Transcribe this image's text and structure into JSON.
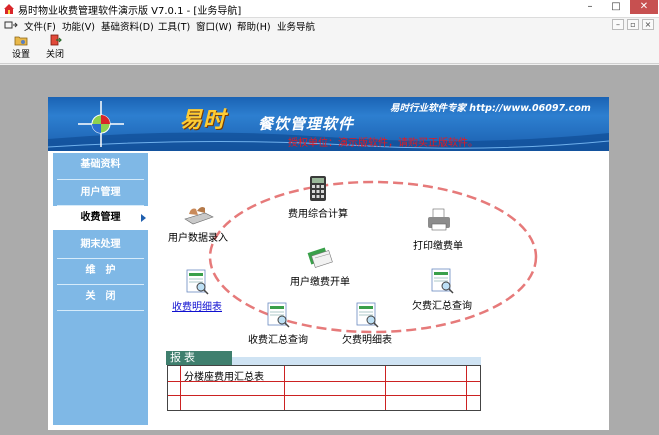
{
  "window": {
    "title": "易时物业收费管理软件演示版 V7.0.1 - [业务导航]",
    "controls": {
      "minimize": "–",
      "maximize": "□",
      "close": "✕"
    }
  },
  "menubar": {
    "items": [
      "文件(F)",
      "功能(V)",
      "基础资料(D)",
      "工具(T)",
      "窗口(W)",
      "帮助(H)",
      "业务导航"
    ],
    "mdi_controls": [
      "–",
      "▫",
      "×"
    ]
  },
  "toolbar": {
    "buttons": [
      {
        "label": "设置",
        "icon": "folder-settings-icon"
      },
      {
        "label": "关闭",
        "icon": "exit-door-icon"
      }
    ]
  },
  "banner": {
    "brand": "易时",
    "product": "餐饮管理软件",
    "tagline": "易时行业软件专家 http://www.06097.com",
    "licensee": "授权单位：演示版软件，请购买正版软件。"
  },
  "nav": {
    "items": [
      "基础资料",
      "用户管理",
      "收费管理",
      "期末处理",
      "维　护",
      "关　闭"
    ],
    "active_index": 2
  },
  "flow": {
    "items": [
      {
        "label": "费用综合计算",
        "icon": "calculator-icon"
      },
      {
        "label": "用户数据录入",
        "icon": "keyboard-hands-icon"
      },
      {
        "label": "用户缴费开单",
        "icon": "invoice-cards-icon"
      },
      {
        "label": "打印缴费单",
        "icon": "printer-icon"
      },
      {
        "label": "收费明细表",
        "icon": "report-magnifier-icon"
      },
      {
        "label": "欠费汇总查询",
        "icon": "report-magnifier-icon"
      },
      {
        "label": "收费汇总查询",
        "icon": "report-magnifier-icon"
      },
      {
        "label": "欠费明细表",
        "icon": "report-magnifier-icon"
      }
    ]
  },
  "report": {
    "tab_label": "报表",
    "rows": [
      "分楼座费用汇总表",
      "",
      ""
    ]
  },
  "colors": {
    "banner_blue": "#1b5fae",
    "nav_blue": "#7fb8e6",
    "licensee_red": "#e8181e",
    "ellipse_red": "#e67a7a",
    "report_tab_green": "#3f7f6e"
  }
}
